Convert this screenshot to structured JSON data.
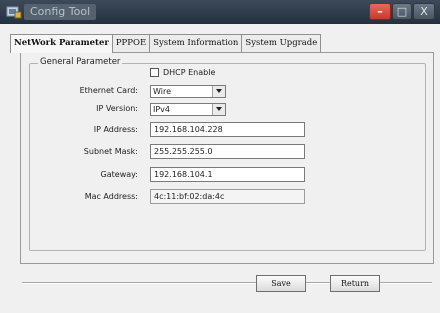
{
  "window": {
    "title": "Config Tool",
    "controls": {
      "minimize": "–",
      "maximize": "□",
      "close": "X"
    }
  },
  "tabs": [
    {
      "label": "NetWork Parameter",
      "active": true
    },
    {
      "label": "PPPOE",
      "active": false
    },
    {
      "label": "System Information",
      "active": false
    },
    {
      "label": "System Upgrade",
      "active": false
    }
  ],
  "general": {
    "legend": "General Parameter",
    "dhcp": {
      "label": "DHCP Enable",
      "checked": false
    },
    "ethernet_card": {
      "label": "Ethernet Card:",
      "value": "Wire"
    },
    "ip_version": {
      "label": "IP Version:",
      "value": "IPv4"
    },
    "ip_address": {
      "label": "IP Address:",
      "value": "192.168.104.228"
    },
    "subnet_mask": {
      "label": "Subnet Mask:",
      "value": "255.255.255.0"
    },
    "gateway": {
      "label": "Gateway:",
      "value": "192.168.104.1"
    },
    "mac_address": {
      "label": "Mac Address:",
      "value": "4c:11:bf:02:da:4c"
    }
  },
  "buttons": {
    "save": "Save",
    "return": "Return"
  },
  "icons": {
    "app": "app-icon",
    "dropdown": "chevron-down-icon"
  }
}
